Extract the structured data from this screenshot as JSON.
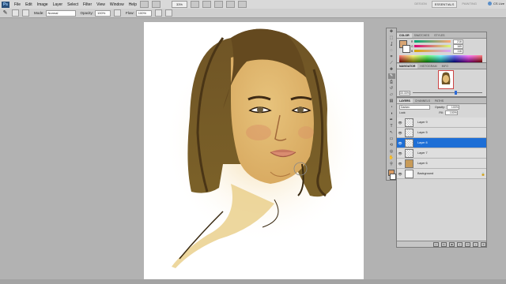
{
  "menubar": {
    "logo": "Ps",
    "items": [
      "File",
      "Edit",
      "Image",
      "Layer",
      "Select",
      "Filter",
      "View",
      "Window",
      "Help"
    ],
    "zoom": "33%",
    "workspaces": [
      "DESIGN",
      "ESSENTIALS",
      "PAINTING"
    ],
    "active_workspace": "ESSENTIALS",
    "cs_live": "CS Live"
  },
  "options": {
    "mode_label": "Mode:",
    "mode_value": "Normal",
    "opacity_label": "Opacity:",
    "opacity_value": "100%",
    "flow_label": "Flow:",
    "flow_value": "100%"
  },
  "tools": {
    "icons": [
      "move-icon",
      "marquee-icon",
      "lasso-icon",
      "quick-select-icon",
      "crop-icon",
      "eyedropper-icon",
      "healing-icon",
      "brush-icon",
      "clone-stamp-icon",
      "history-brush-icon",
      "eraser-icon",
      "gradient-icon",
      "blur-icon",
      "dodge-icon",
      "pen-icon",
      "type-icon",
      "path-select-icon",
      "shape-icon",
      "3d-rotate-icon",
      "3d-camera-icon",
      "hand-icon",
      "zoom-icon"
    ],
    "glyphs": [
      "✥",
      "⬚",
      "ʆ",
      "◌",
      "⌗",
      "⟋",
      "✚",
      "✎",
      "⎙",
      "↺",
      "▱",
      "▤",
      "◔",
      "◑",
      "✒",
      "T",
      "↖",
      "▭",
      "⟲",
      "◎",
      "✋",
      "⚲"
    ],
    "active_index": 7
  },
  "color_panel": {
    "tabs": [
      "COLOR",
      "SWATCHES",
      "STYLES"
    ],
    "channels": [
      {
        "name": "R",
        "value": "216"
      },
      {
        "name": "G",
        "value": "165"
      },
      {
        "name": "B",
        "value": "116"
      }
    ],
    "fg_color": "#d8a574",
    "bg_color": "#ffffff"
  },
  "navigator_panel": {
    "tabs": [
      "NAVIGATOR",
      "HISTOGRAM",
      "INFO"
    ],
    "zoom": "33.33%"
  },
  "layers_panel": {
    "tabs": [
      "LAYERS",
      "CHANNELS",
      "PATHS"
    ],
    "blend_mode": "Darken",
    "opacity_label": "Opacity:",
    "opacity_value": "100%",
    "lock_label": "Lock:",
    "fill_label": "Fill:",
    "fill_value": "100%",
    "layers": [
      {
        "name": "Layer 9",
        "thumb": "transparent",
        "selected": false
      },
      {
        "name": "Layer 5",
        "thumb": "transparent",
        "selected": false
      },
      {
        "name": "Layer 8",
        "thumb": "transparent",
        "selected": true
      },
      {
        "name": "Layer 7",
        "thumb": "transparent",
        "selected": false
      },
      {
        "name": "Layer 6",
        "thumb": "painted",
        "selected": false
      },
      {
        "name": "Background",
        "thumb": "white",
        "selected": false,
        "locked": true
      }
    ]
  }
}
